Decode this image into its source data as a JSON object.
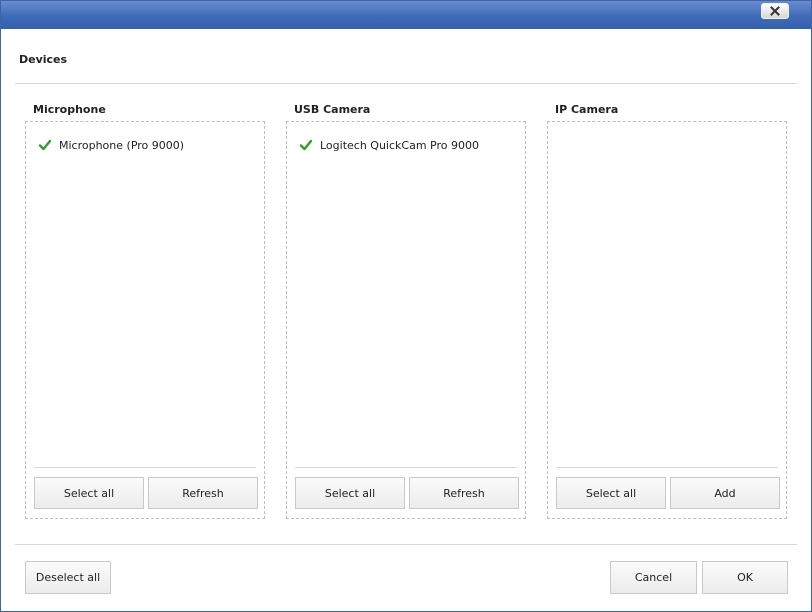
{
  "header": {
    "title": "Devices",
    "close_icon": "close-icon"
  },
  "panels": [
    {
      "title": "Microphone",
      "items": [
        {
          "label": "Microphone (Pro 9000)",
          "checked": true
        }
      ],
      "buttons": [
        "Select all",
        "Refresh"
      ]
    },
    {
      "title": "USB Camera",
      "items": [
        {
          "label": "Logitech QuickCam Pro 9000",
          "checked": true
        }
      ],
      "buttons": [
        "Select all",
        "Refresh"
      ]
    },
    {
      "title": "IP Camera",
      "items": [],
      "buttons": [
        "Select all",
        "Add"
      ]
    }
  ],
  "footer": {
    "deselect_label": "Deselect all",
    "cancel_label": "Cancel",
    "ok_label": "OK"
  },
  "colors": {
    "titlebar": "#3f6ab8",
    "check": "#2e9e2e",
    "panel_border": "#bcbcbc"
  }
}
